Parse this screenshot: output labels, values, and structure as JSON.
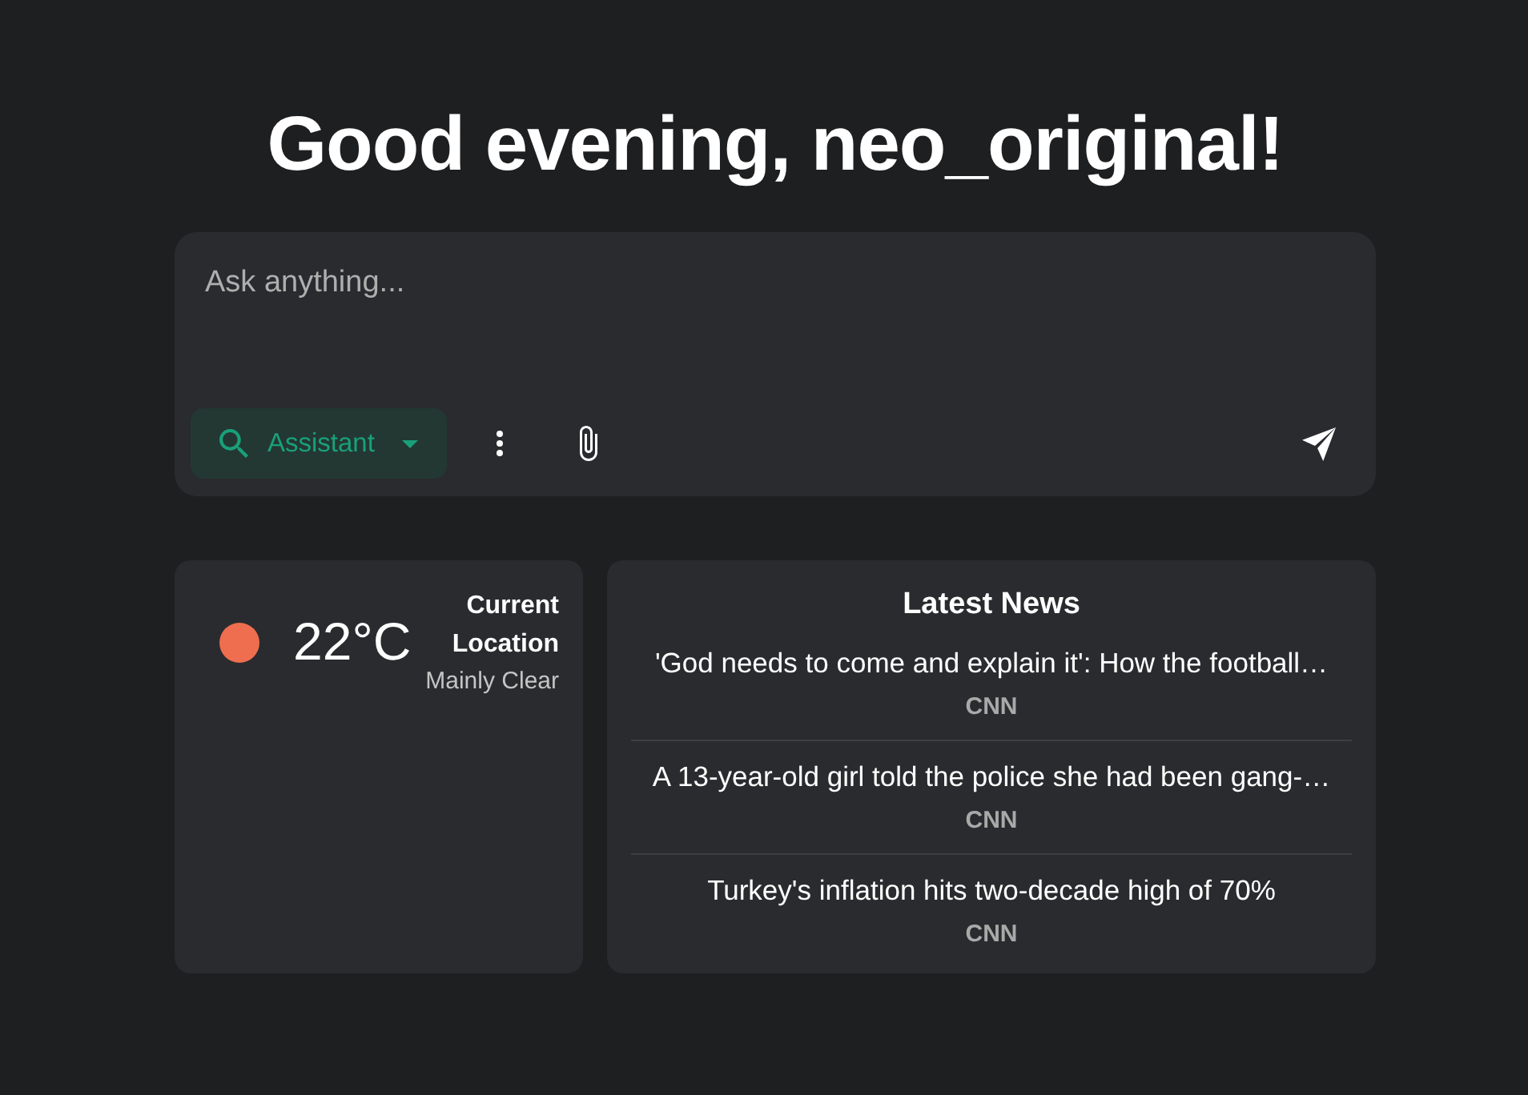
{
  "greeting": "Good evening, neo_original!",
  "composer": {
    "placeholder": "Ask anything...",
    "mode": {
      "label": "Assistant"
    }
  },
  "weather": {
    "temperature": "22°C",
    "location": "Current Location",
    "condition": "Mainly Clear"
  },
  "news": {
    "title": "Latest News",
    "items": [
      {
        "headline": "'God needs to come and explain it': How the football…",
        "source": "CNN"
      },
      {
        "headline": "A 13-year-old girl told the police she had been gang-…",
        "source": "CNN"
      },
      {
        "headline": "Turkey's inflation hits two-decade high of 70%",
        "source": "CNN"
      }
    ]
  }
}
